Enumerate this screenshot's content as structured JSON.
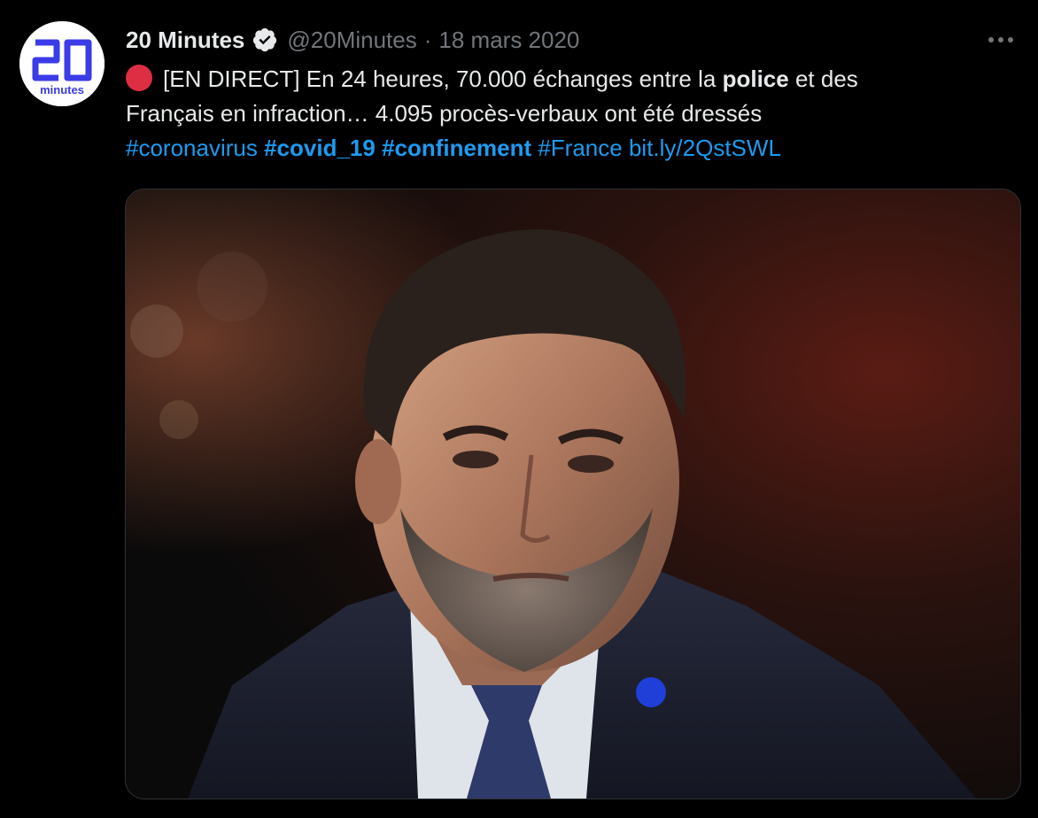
{
  "tweet": {
    "author": {
      "display_name": "20 Minutes",
      "handle": "@20Minutes",
      "verified": true,
      "avatar_icon": "20minutes-logo",
      "avatar_text_big": "20",
      "avatar_text_small": "minutes"
    },
    "separator": "·",
    "date": "18 mars 2020",
    "more_icon": "more-horizontal-icon",
    "text": {
      "status_icon": "red-circle-icon",
      "line1_before": "[EN DIRECT] En 24 heures, 70.000 échanges entre la ",
      "line1_bold": "police",
      "line1_after": " et des",
      "line2": "Français en infraction… 4.095 procès-verbaux ont été dressés",
      "hashtags": [
        {
          "text": "#coronavirus",
          "bold": false
        },
        {
          "text": "#covid_19",
          "bold": true
        },
        {
          "text": "#confinement",
          "bold": true
        },
        {
          "text": "#France",
          "bold": false
        }
      ],
      "link": "bit.ly/2QstSWL"
    },
    "media": {
      "kind": "photo"
    },
    "colors": {
      "background": "#000000",
      "text": "#e7e9ea",
      "muted": "#71767b",
      "link": "#1d9bf0",
      "brand": "#3b3be8",
      "status_red": "#dd2e44"
    }
  }
}
